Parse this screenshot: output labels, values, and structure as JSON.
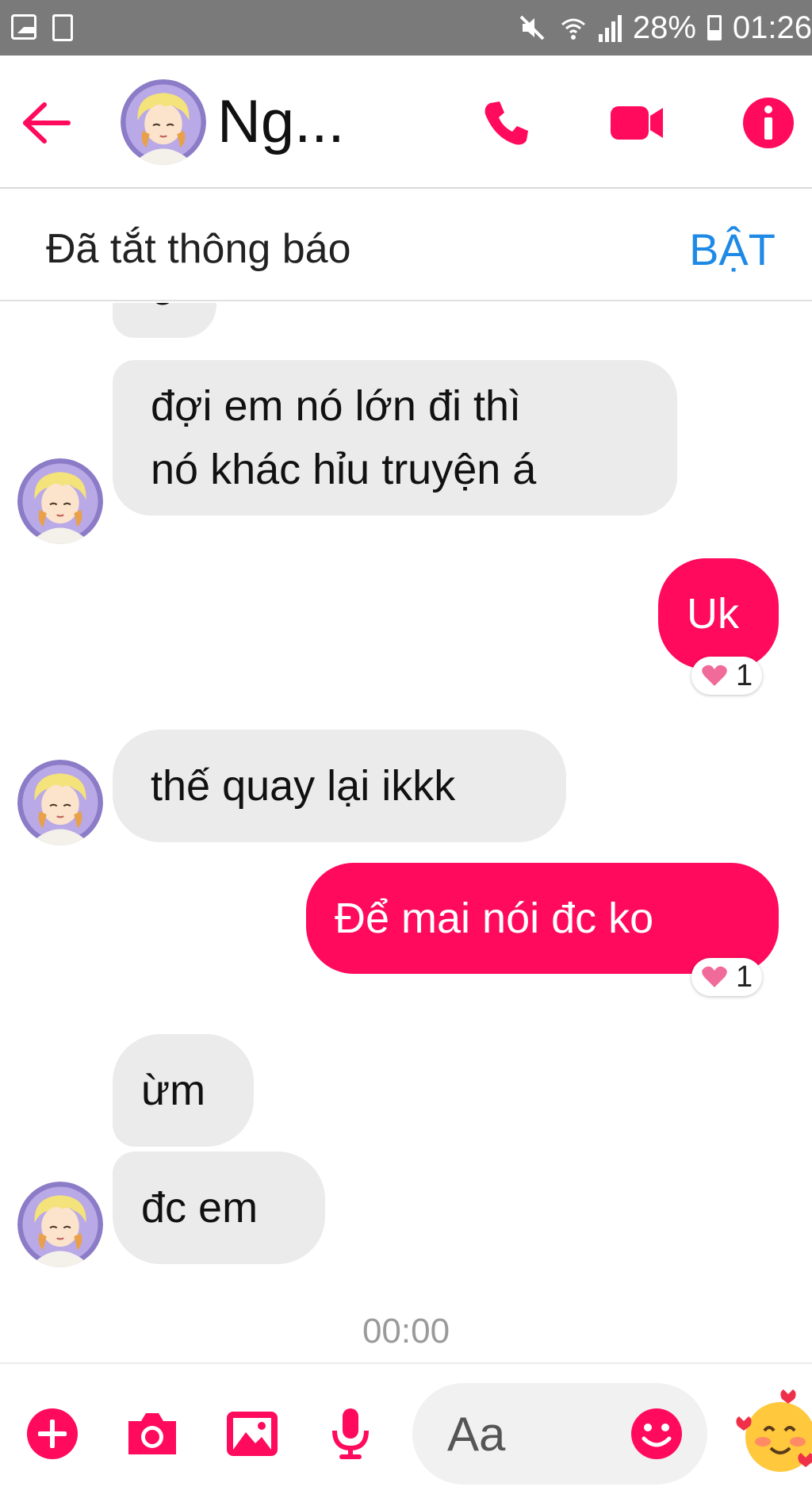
{
  "status_bar": {
    "battery_percent": "28%",
    "time": "01:26"
  },
  "header": {
    "contact_name": "Ng...",
    "accent_color": "#ff0a5c"
  },
  "notification_banner": {
    "text": "Đã tắt thông báo",
    "action_label": "BẬT",
    "action_color": "#1f8ae6"
  },
  "messages": [
    {
      "from": "them",
      "text": "ơ"
    },
    {
      "from": "them",
      "text_lines": [
        "đợi em nó lớn đi thì",
        "nó khác hỉu truyện á"
      ]
    },
    {
      "from": "me",
      "text": "Uk",
      "reaction": {
        "icon": "heart-icon",
        "count": "1"
      }
    },
    {
      "from": "them",
      "text": "thế quay lại ikkk"
    },
    {
      "from": "me",
      "text": "Để mai nói đc ko",
      "reaction": {
        "icon": "heart-icon",
        "count": "1"
      }
    },
    {
      "from": "them",
      "text": "ừm"
    },
    {
      "from": "them",
      "text": "đc em"
    }
  ],
  "timestamp": "00:00",
  "composer": {
    "placeholder": "Aa",
    "icons": [
      "plus-icon",
      "camera-icon",
      "gallery-icon",
      "microphone-icon",
      "emoji-icon",
      "sticker-icon"
    ]
  }
}
